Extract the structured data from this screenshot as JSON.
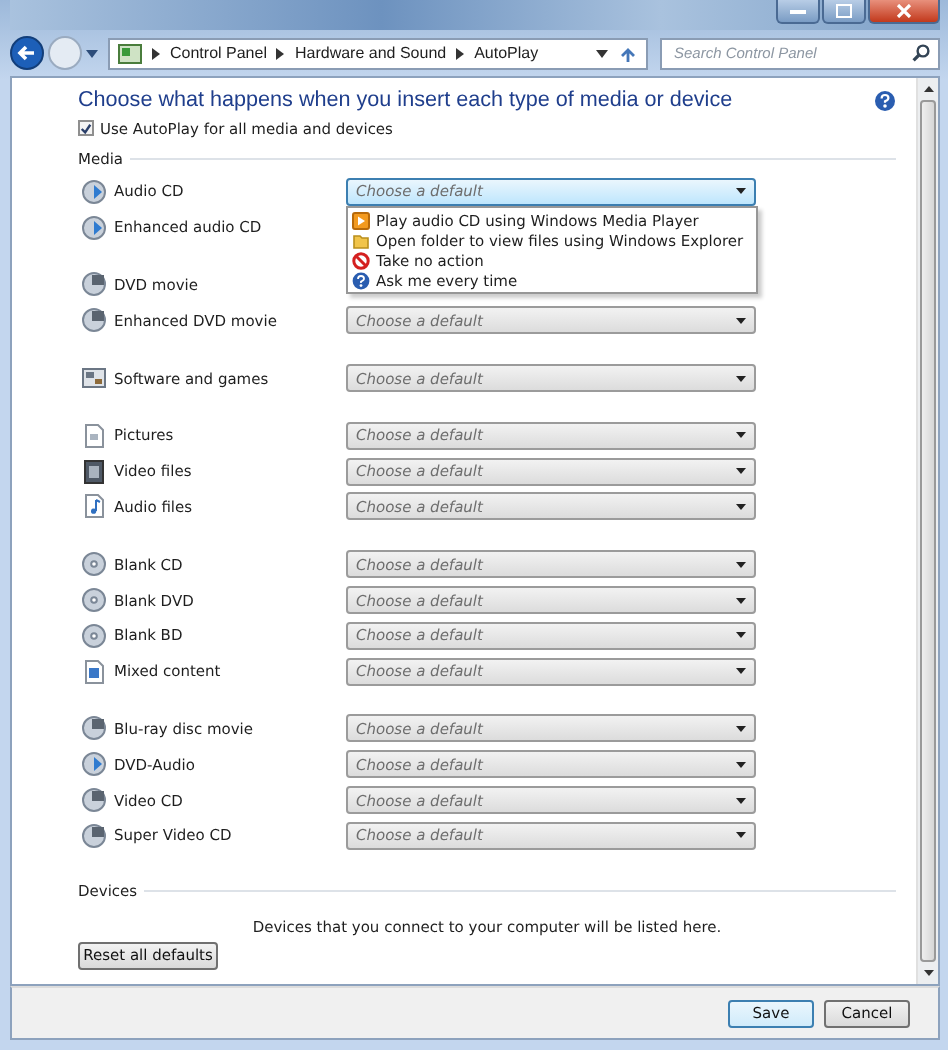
{
  "address_bar": {
    "breadcrumb": [
      "Control Panel",
      "Hardware and Sound",
      "AutoPlay"
    ]
  },
  "search": {
    "placeholder": "Search Control Panel"
  },
  "heading": "Choose what happens when you insert each type of media or device",
  "autoplay_checkbox": {
    "label": "Use AutoPlay for all media and devices",
    "checked": true
  },
  "media": {
    "title": "Media",
    "groups": [
      [
        {
          "label": "Audio CD",
          "kind": "cd",
          "value": "Choose a default",
          "open": true,
          "options": [
            {
              "label": "Play audio CD using Windows Media Player",
              "kind": "play"
            },
            {
              "label": "Open folder to view files using Windows Explorer",
              "kind": "folder"
            },
            {
              "label": "Take no action",
              "kind": "none"
            },
            {
              "label": "Ask me every time",
              "kind": "ask"
            }
          ]
        },
        {
          "label": "Enhanced audio CD",
          "kind": "cd"
        }
      ],
      [
        {
          "label": "DVD movie",
          "kind": "dvd"
        },
        {
          "label": "Enhanced DVD movie",
          "kind": "dvd",
          "value": "Choose a default",
          "open": false
        }
      ],
      [
        {
          "label": "Software and games",
          "kind": "software",
          "value": "Choose a default",
          "open": false
        }
      ],
      [
        {
          "label": "Pictures",
          "kind": "pictures",
          "value": "Choose a default",
          "open": false
        },
        {
          "label": "Video files",
          "kind": "video",
          "value": "Choose a default",
          "open": false
        },
        {
          "label": "Audio files",
          "kind": "audio",
          "value": "Choose a default",
          "open": false
        }
      ],
      [
        {
          "label": "Blank CD",
          "kind": "blank",
          "value": "Choose a default",
          "open": false
        },
        {
          "label": "Blank DVD",
          "kind": "blank",
          "value": "Choose a default",
          "open": false
        },
        {
          "label": "Blank BD",
          "kind": "blank",
          "value": "Choose a default",
          "open": false
        },
        {
          "label": "Mixed content",
          "kind": "mixed",
          "value": "Choose a default",
          "open": false
        }
      ],
      [
        {
          "label": "Blu-ray disc movie",
          "kind": "dvd",
          "value": "Choose a default",
          "open": false
        },
        {
          "label": "DVD-Audio",
          "kind": "cd",
          "value": "Choose a default",
          "open": false
        },
        {
          "label": "Video CD",
          "kind": "dvd",
          "value": "Choose a default",
          "open": false
        },
        {
          "label": "Super Video CD",
          "kind": "dvd",
          "value": "Choose a default",
          "open": false
        }
      ]
    ]
  },
  "devices": {
    "title": "Devices",
    "message": "Devices that you connect to your computer will be listed here."
  },
  "reset_button": "Reset all defaults",
  "buttons": [
    "Save",
    "Cancel"
  ]
}
